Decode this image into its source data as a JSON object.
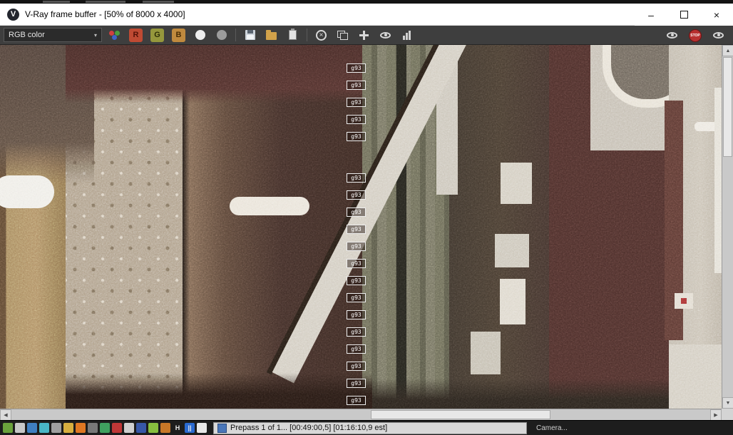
{
  "window": {
    "title": "V-Ray frame buffer - [50% of 8000 x 4000]",
    "logo_letter": "V",
    "minimize_glyph": "–",
    "close_glyph": "×"
  },
  "toolbar": {
    "channel_dropdown_value": "RGB color",
    "dropdown_arrow": "▾",
    "red_channel": "R",
    "green_channel": "G",
    "blue_channel": "B",
    "clear_glyph": "×",
    "stop_label": "STOP"
  },
  "render": {
    "g93_labels": [
      "g93",
      "g93",
      "g93",
      "g93",
      "g93",
      "g93",
      "g93",
      "g93",
      "g93",
      "g93",
      "g93",
      "g93",
      "g93",
      "g93",
      "g93",
      "g93",
      "g93",
      "g93",
      "g93"
    ]
  },
  "scrollbar": {
    "up": "▲",
    "down": "▼",
    "left": "◀",
    "right": "▶"
  },
  "taskbar": {
    "icons": [
      {
        "color": "#6aa23c"
      },
      {
        "color": "#c8c8c8"
      },
      {
        "color": "#3f7fc1"
      },
      {
        "color": "#49b6c6"
      },
      {
        "color": "#9f9f9f"
      },
      {
        "color": "#d7af3f"
      },
      {
        "color": "#df7722"
      },
      {
        "color": "#787878"
      },
      {
        "color": "#3fa05f"
      },
      {
        "color": "#bf3737"
      },
      {
        "color": "#cfcfcf"
      },
      {
        "color": "#3757a7"
      },
      {
        "color": "#87bf3f"
      },
      {
        "color": "#c77727"
      },
      {
        "color": "transparent",
        "label": "H"
      },
      {
        "color": "#2a6ad0",
        "label": "||"
      },
      {
        "color": "#e8e8e8"
      }
    ],
    "progress_text": "Prepass 1 of 1... [00:49:00,5] [01:16:10,9 est]",
    "camera_label": "Camera..."
  }
}
